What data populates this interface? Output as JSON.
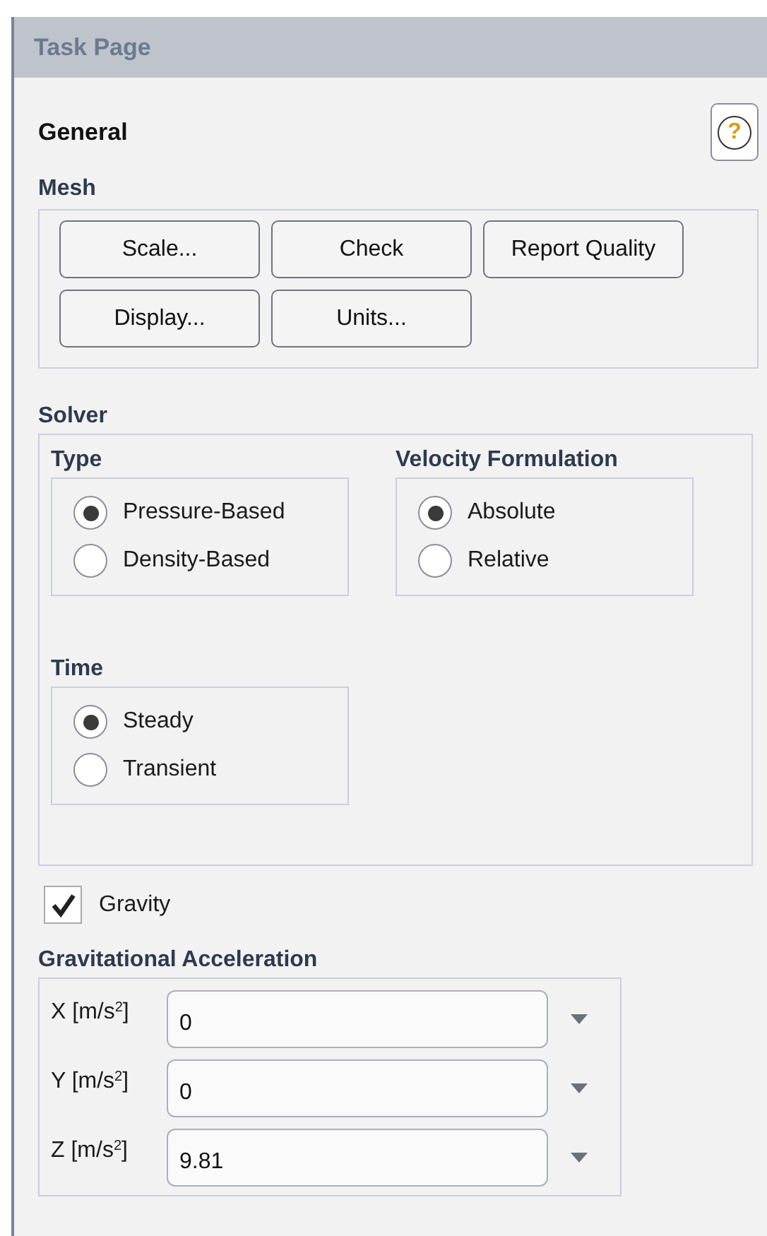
{
  "panel": {
    "title": "Task Page"
  },
  "page": {
    "title": "General",
    "help_label": "?"
  },
  "mesh": {
    "title": "Mesh",
    "buttons": [
      "Scale...",
      "Check",
      "Report Quality",
      "Display...",
      "Units..."
    ]
  },
  "solver": {
    "title": "Solver",
    "groups": [
      {
        "title": "Type",
        "options": [
          {
            "label": "Pressure-Based",
            "selected": true
          },
          {
            "label": "Density-Based",
            "selected": false
          }
        ]
      },
      {
        "title": "Velocity Formulation",
        "options": [
          {
            "label": "Absolute",
            "selected": true
          },
          {
            "label": "Relative",
            "selected": false
          }
        ]
      },
      {
        "title": "Time",
        "options": [
          {
            "label": "Steady",
            "selected": true
          },
          {
            "label": "Transient",
            "selected": false
          }
        ]
      }
    ]
  },
  "gravity": {
    "label": "Gravity",
    "checked": true
  },
  "acceleration": {
    "title": "Gravitational Acceleration",
    "fields": [
      {
        "label": "X [m/s$^{2}$]",
        "value": "0"
      },
      {
        "label": "Y [m/s$^{2}$]",
        "value": "0"
      },
      {
        "label": "Z [m/s$^{2}$]",
        "value": "9.81"
      }
    ]
  }
}
